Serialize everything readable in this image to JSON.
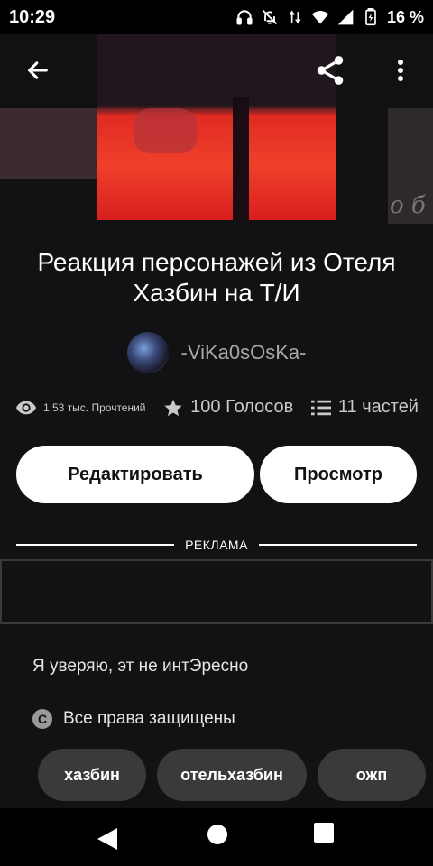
{
  "status_bar": {
    "time": "10:29",
    "battery_percent": "16 %",
    "icons": [
      "headphones-icon",
      "bell-off-icon",
      "data-transfer-icon",
      "wifi-icon",
      "cell-signal-icon",
      "battery-charging-icon"
    ]
  },
  "toolbar": {
    "back_icon": "arrow-left-icon",
    "share_icon": "share-icon",
    "more_icon": "more-vertical-icon"
  },
  "cover": {
    "side_text": "о б"
  },
  "story": {
    "title_line1": "Реакция персонажей из Отеля",
    "title_line2": "Хазбин на Т/И",
    "author": "-ViKa0sOsKa-"
  },
  "stats": {
    "reads": "1,53 тыс. Прочтений",
    "votes": "100 Голосов",
    "parts": "11 частей"
  },
  "actions": {
    "edit_label": "Редактировать",
    "view_label": "Просмотр"
  },
  "ad": {
    "label": "РЕКЛАМА"
  },
  "description": "Я уверяю, эт не интЭресно",
  "copyright": {
    "text": "Все права защищены",
    "icon_text": "C"
  },
  "tags": [
    "хазбин",
    "отельхазбин",
    "ожп"
  ],
  "colors": {
    "background": "#121114",
    "button_bg": "#ffffff",
    "tag_bg": "#3a393c",
    "muted_text": "#a9a7aa"
  }
}
